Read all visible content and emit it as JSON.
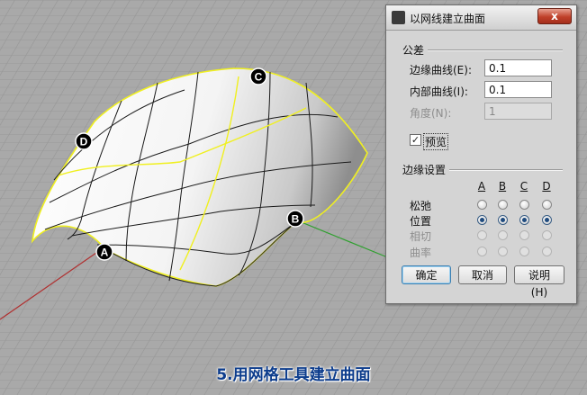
{
  "caption": "5.用网格工具建立曲面",
  "viewport": {
    "markers": [
      "A",
      "B",
      "C",
      "D"
    ]
  },
  "dialog": {
    "title": "以网线建立曲面",
    "close_glyph": "x",
    "tolerance": {
      "label": "公差",
      "edge_curves_label": "边缘曲线(E):",
      "edge_curves_value": "0.1",
      "inner_curves_label": "内部曲线(I):",
      "inner_curves_value": "0.1",
      "angle_label": "角度(N):",
      "angle_value": "1"
    },
    "preview": {
      "label": "预览",
      "checked": true
    },
    "edge_settings": {
      "label": "边缘设置",
      "columns": [
        "A",
        "B",
        "C",
        "D"
      ],
      "rows": [
        {
          "label": "松弛",
          "selected": false,
          "enabled": true
        },
        {
          "label": "位置",
          "selected": true,
          "enabled": true
        },
        {
          "label": "相切",
          "selected": false,
          "enabled": false
        },
        {
          "label": "曲率",
          "selected": false,
          "enabled": false
        }
      ]
    },
    "buttons": {
      "ok": "确定",
      "cancel": "取消",
      "help": "说明(H)"
    }
  },
  "colors": {
    "surface_edge": "#f0f020",
    "grid": "#9a9a9a",
    "x_axis": "#b03030",
    "y_axis": "#30a030",
    "close": "#c0412a"
  }
}
